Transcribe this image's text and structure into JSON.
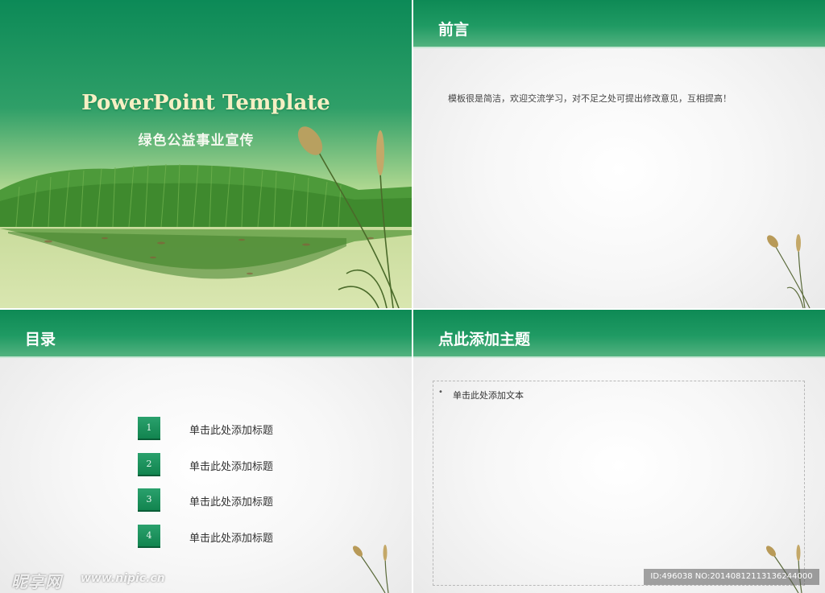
{
  "cover": {
    "title": "PowerPoint Template",
    "subtitle": "绿色公益事业宣传"
  },
  "preface": {
    "header": "前言",
    "body": "模板很是简洁，欢迎交流学习，对不足之处可提出修改意见，互相提高！"
  },
  "toc": {
    "header": "目录",
    "items": [
      {
        "number": "1",
        "label": "单击此处添加标题"
      },
      {
        "number": "2",
        "label": "单击此处添加标题"
      },
      {
        "number": "3",
        "label": "单击此处添加标题"
      },
      {
        "number": "4",
        "label": "单击此处添加标题"
      }
    ]
  },
  "content": {
    "header": "点此添加主题",
    "bullet": "•",
    "bullet_text": "单击此处添加文本"
  },
  "watermark": {
    "logo": "昵享网",
    "url": "www.nipic.cn",
    "id_text": "ID:496038 NO:20140812113136244000"
  },
  "colors": {
    "header_green": "#1f9a63",
    "cover_title": "#f6efc4",
    "number_box": "#12844f"
  },
  "icons": {
    "reed": "reed-grass-icon"
  }
}
